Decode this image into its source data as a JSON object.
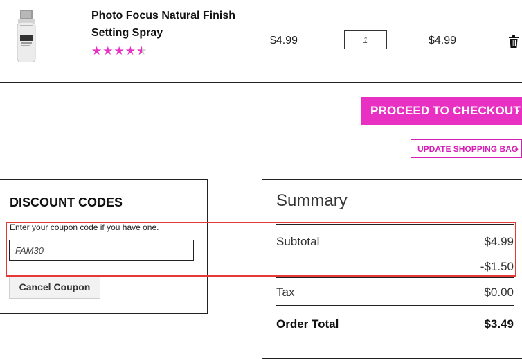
{
  "product": {
    "name": "Photo Focus Natural Finish Setting Spray",
    "rating_value": 4.5,
    "rating_max": 5,
    "price": "$4.99",
    "quantity": "1",
    "row_total": "$4.99",
    "thumbnail_label": "NATURAL FINISH"
  },
  "actions": {
    "checkout_label": "PROCEED TO CHECKOUT",
    "update_label": "UPDATE SHOPPING BAG"
  },
  "discount": {
    "title": "DISCOUNT CODES",
    "hint": "Enter your coupon code if you have one.",
    "code_value": "FAM30",
    "cancel_label": "Cancel Coupon"
  },
  "summary": {
    "title": "Summary",
    "subtotal_label": "Subtotal",
    "subtotal_value": "$4.99",
    "discount_value": "-$1.50",
    "tax_label": "Tax",
    "tax_value": "$0.00",
    "order_total_label": "Order Total",
    "order_total_value": "$3.49"
  },
  "colors": {
    "accent": "#e831c3",
    "highlight": "#e53935"
  },
  "icons": {
    "trash": "trash-icon",
    "chevron": "chevron-right-icon",
    "star": "star-icon"
  }
}
